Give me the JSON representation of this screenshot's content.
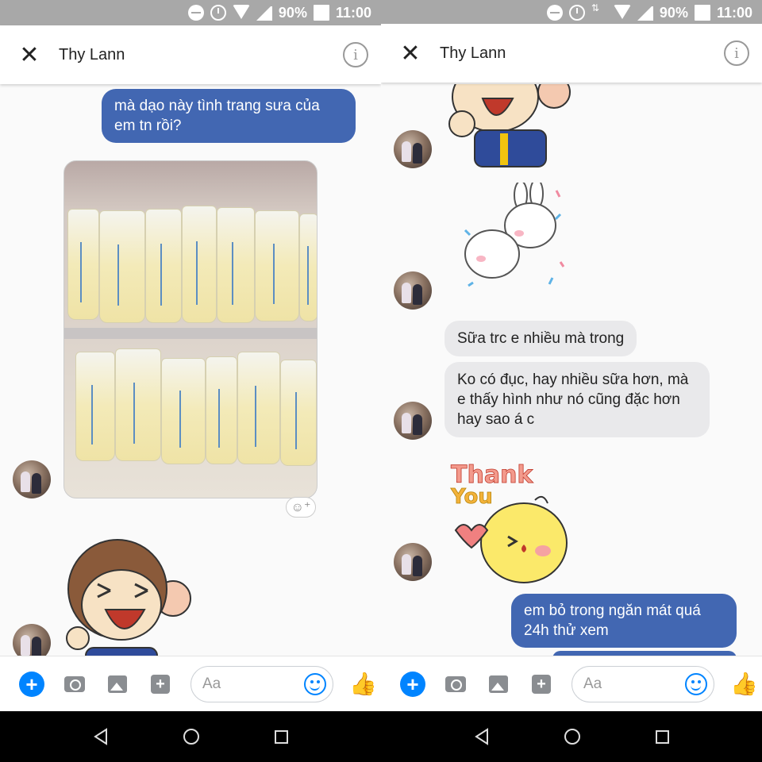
{
  "status_bar": {
    "battery": "90%",
    "time": "11:00"
  },
  "conversation": {
    "contact_name": "Thy Lann"
  },
  "left_screen": {
    "messages": [
      {
        "type": "outgoing",
        "text": "mà dạo này tình trang sưa của em tn rồi?"
      },
      {
        "type": "incoming_photo",
        "description_label": "breast milk bags in freezer"
      },
      {
        "type": "incoming_sticker",
        "sticker": "monkey-laughing"
      }
    ]
  },
  "right_screen": {
    "messages": [
      {
        "type": "incoming_sticker",
        "sticker": "monkey-laughing"
      },
      {
        "type": "incoming_sticker",
        "sticker": "bunnies-hugging"
      },
      {
        "type": "incoming",
        "text": "Sữa trc e nhiều mà trong"
      },
      {
        "type": "incoming",
        "text": "Ko có đục, hay nhiều sữa hơn, mà e thấy hình như nó cũng đặc hơn hay sao á c"
      },
      {
        "type": "incoming_sticker",
        "sticker": "thank-you-chick",
        "sticker_text_1": "Thank",
        "sticker_text_2": "You"
      },
      {
        "type": "outgoing",
        "text": "em bỏ trong ngăn mát quá 24h thử xem"
      }
    ]
  },
  "composer": {
    "placeholder": "Aa"
  },
  "colors": {
    "outgoing_bubble": "#4267b2",
    "incoming_bubble": "#e9e9eb",
    "accent": "#0084ff",
    "status_bar": "#a8a8a8"
  }
}
